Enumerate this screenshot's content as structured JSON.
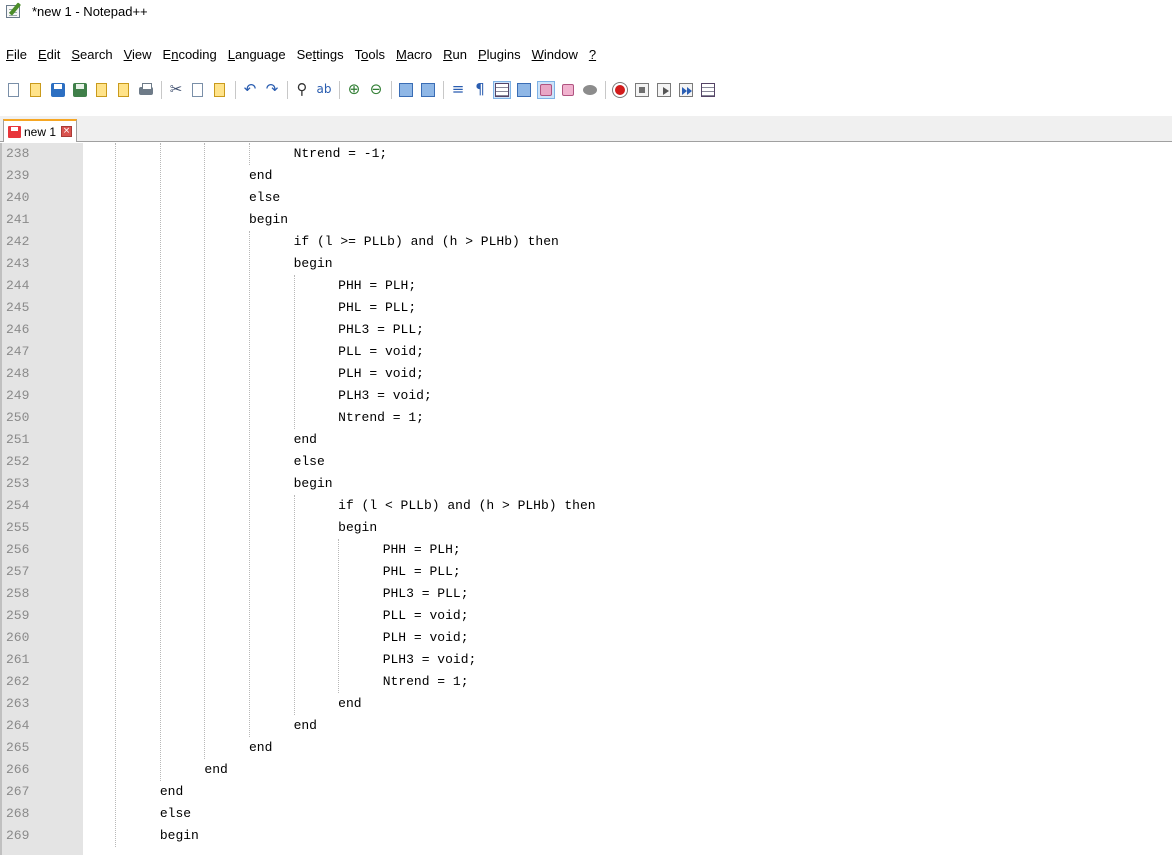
{
  "window": {
    "title": "*new 1 - Notepad++"
  },
  "menu": [
    {
      "pre": "",
      "u": "F",
      "post": "ile"
    },
    {
      "pre": "",
      "u": "E",
      "post": "dit"
    },
    {
      "pre": "",
      "u": "S",
      "post": "earch"
    },
    {
      "pre": "",
      "u": "V",
      "post": "iew"
    },
    {
      "pre": "E",
      "u": "n",
      "post": "coding"
    },
    {
      "pre": "",
      "u": "L",
      "post": "anguage"
    },
    {
      "pre": "Se",
      "u": "t",
      "post": "tings"
    },
    {
      "pre": "T",
      "u": "o",
      "post": "ols"
    },
    {
      "pre": "",
      "u": "M",
      "post": "acro"
    },
    {
      "pre": "",
      "u": "R",
      "post": "un"
    },
    {
      "pre": "",
      "u": "P",
      "post": "lugins"
    },
    {
      "pre": "",
      "u": "W",
      "post": "indow"
    },
    {
      "pre": "",
      "u": "?",
      "post": ""
    }
  ],
  "toolbar": {
    "icons": [
      "new-file-icon",
      "open-file-icon",
      "save-icon",
      "save-all-icon",
      "close-icon",
      "close-all-icon",
      "print-icon",
      "cut-icon",
      "copy-icon",
      "paste-icon",
      "undo-icon",
      "redo-icon",
      "find-icon",
      "replace-icon",
      "zoom-in-icon",
      "zoom-out-icon",
      "sync-vertical-icon",
      "sync-horizontal-icon",
      "word-wrap-icon",
      "show-all-chars-icon",
      "indent-guide-icon",
      "doc-map-icon",
      "function-list-icon",
      "folder-workspace-icon",
      "monitoring-icon",
      "record-macro-icon",
      "stop-record-icon",
      "play-macro-icon",
      "run-macro-multiple-icon",
      "save-macro-icon"
    ]
  },
  "tab": {
    "label": "new 1",
    "close_glyph": "×"
  },
  "editor": {
    "lines": [
      {
        "n": "238",
        "indent": 9,
        "text": "Ntrend = -1;"
      },
      {
        "n": "239",
        "indent": 7,
        "text": "end"
      },
      {
        "n": "240",
        "indent": 7,
        "text": "else"
      },
      {
        "n": "241",
        "indent": 7,
        "text": "begin"
      },
      {
        "n": "242",
        "indent": 9,
        "text": "if (l >= PLLb) and (h > PLHb) then"
      },
      {
        "n": "243",
        "indent": 9,
        "text": "begin"
      },
      {
        "n": "244",
        "indent": 11,
        "text": "PHH = PLH;"
      },
      {
        "n": "245",
        "indent": 11,
        "text": "PHL = PLL;"
      },
      {
        "n": "246",
        "indent": 11,
        "text": "PHL3 = PLL;"
      },
      {
        "n": "247",
        "indent": 11,
        "text": "PLL = void;"
      },
      {
        "n": "248",
        "indent": 11,
        "text": "PLH = void;"
      },
      {
        "n": "249",
        "indent": 11,
        "text": "PLH3 = void;"
      },
      {
        "n": "250",
        "indent": 11,
        "text": "Ntrend = 1;"
      },
      {
        "n": "251",
        "indent": 9,
        "text": "end"
      },
      {
        "n": "252",
        "indent": 9,
        "text": "else"
      },
      {
        "n": "253",
        "indent": 9,
        "text": "begin"
      },
      {
        "n": "254",
        "indent": 11,
        "text": "if (l < PLLb) and (h > PLHb) then"
      },
      {
        "n": "255",
        "indent": 11,
        "text": "begin"
      },
      {
        "n": "256",
        "indent": 13,
        "text": "PHH = PLH;"
      },
      {
        "n": "257",
        "indent": 13,
        "text": "PHL = PLL;"
      },
      {
        "n": "258",
        "indent": 13,
        "text": "PHL3 = PLL;"
      },
      {
        "n": "259",
        "indent": 13,
        "text": "PLL = void;"
      },
      {
        "n": "260",
        "indent": 13,
        "text": "PLH = void;"
      },
      {
        "n": "261",
        "indent": 13,
        "text": "PLH3 = void;"
      },
      {
        "n": "262",
        "indent": 13,
        "text": "Ntrend = 1;"
      },
      {
        "n": "263",
        "indent": 11,
        "text": "end"
      },
      {
        "n": "264",
        "indent": 9,
        "text": "end"
      },
      {
        "n": "265",
        "indent": 7,
        "text": "end"
      },
      {
        "n": "266",
        "indent": 5,
        "text": "end"
      },
      {
        "n": "267",
        "indent": 3,
        "text": "end"
      },
      {
        "n": "268",
        "indent": 3,
        "text": "else"
      },
      {
        "n": "269",
        "indent": 3,
        "text": "begin"
      }
    ]
  }
}
